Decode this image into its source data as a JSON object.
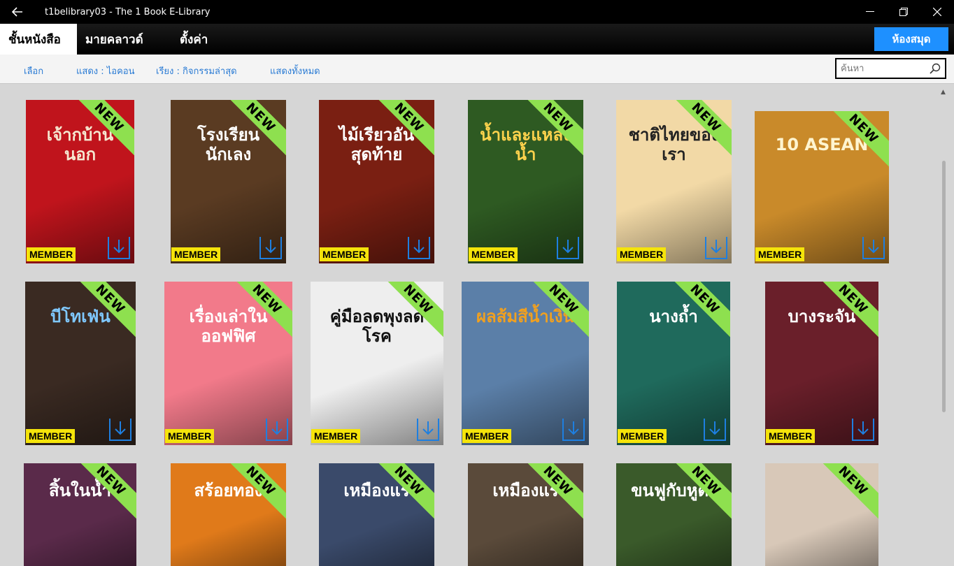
{
  "window": {
    "title": "t1belibrary03 - The 1 Book E-Library"
  },
  "nav": {
    "tabs": [
      {
        "label": "ชั้นหนังสือ",
        "active": true
      },
      {
        "label": "มายคลาวด์",
        "active": false
      },
      {
        "label": "ตั้งค่า",
        "active": false
      }
    ],
    "library_button": "ห้องสมุด"
  },
  "toolbar": {
    "select": "เลือก",
    "view": "แสดง : ไอคอน",
    "sort": "เรียง : กิจกรรมล่าสุด",
    "show_all": "แสดงทั้งหมด",
    "search_placeholder": "ค้นหา"
  },
  "badges": {
    "new": "NEW",
    "member": "MEMBER"
  },
  "colors": {
    "accent": "#1e90ff",
    "new_ribbon": "#8ee04f",
    "member_badge": "#f5e40a",
    "link": "#2a7bd4"
  },
  "books": [
    {
      "title": "เจ้ากบ้านนอก",
      "cover": "#c0141c",
      "text": "#f5e7d0"
    },
    {
      "title": "โรงเรียนนักเลง",
      "cover": "#5a3b22",
      "text": "#ffffff"
    },
    {
      "title": "ไม้เรียวอันสุดท้าย",
      "cover": "#7a1f12",
      "text": "#ffffff"
    },
    {
      "title": "น้ำและแหล่งน้ำ",
      "cover": "#2e5a22",
      "text": "#ffd34d"
    },
    {
      "title": "ชาติไทยของเรา",
      "cover": "#f2d9a6",
      "text": "#222222"
    },
    {
      "title": "10 ASEAN",
      "cover": "#c98a2a",
      "text": "#fff5d0"
    },
    {
      "title": "บีโทเฟ่น",
      "cover": "#3a2a22",
      "text": "#7fc8ff"
    },
    {
      "title": "เรื่องเล่าในออฟฟิศ",
      "cover": "#f27a8a",
      "text": "#ffffff"
    },
    {
      "title": "คู่มือลดพุงลดโรค",
      "cover": "#eeeeee",
      "text": "#111111"
    },
    {
      "title": "ผลส้มสีน้ำเงิน",
      "cover": "#5b7fa8",
      "text": "#f0a020"
    },
    {
      "title": "นางถ้ำ",
      "cover": "#1f6a5c",
      "text": "#ffffff"
    },
    {
      "title": "บางระจัน",
      "cover": "#6a1f2a",
      "text": "#ffffff"
    },
    {
      "title": "สิ้นในน้ำ",
      "cover": "#5a2a4a",
      "text": "#ffffff"
    },
    {
      "title": "สร้อยทอง",
      "cover": "#e07a1a",
      "text": "#ffffff"
    },
    {
      "title": "เหมืองแร่",
      "cover": "#3a4a6a",
      "text": "#ffffff"
    },
    {
      "title": "เหมืองแร่",
      "cover": "#5a4a3a",
      "text": "#ffffff"
    },
    {
      "title": "ขนฟูกับหูตั้ง",
      "cover": "#3a5a2a",
      "text": "#ffffff"
    },
    {
      "title": "",
      "cover": "#d8c8b8",
      "text": "#333333"
    }
  ]
}
